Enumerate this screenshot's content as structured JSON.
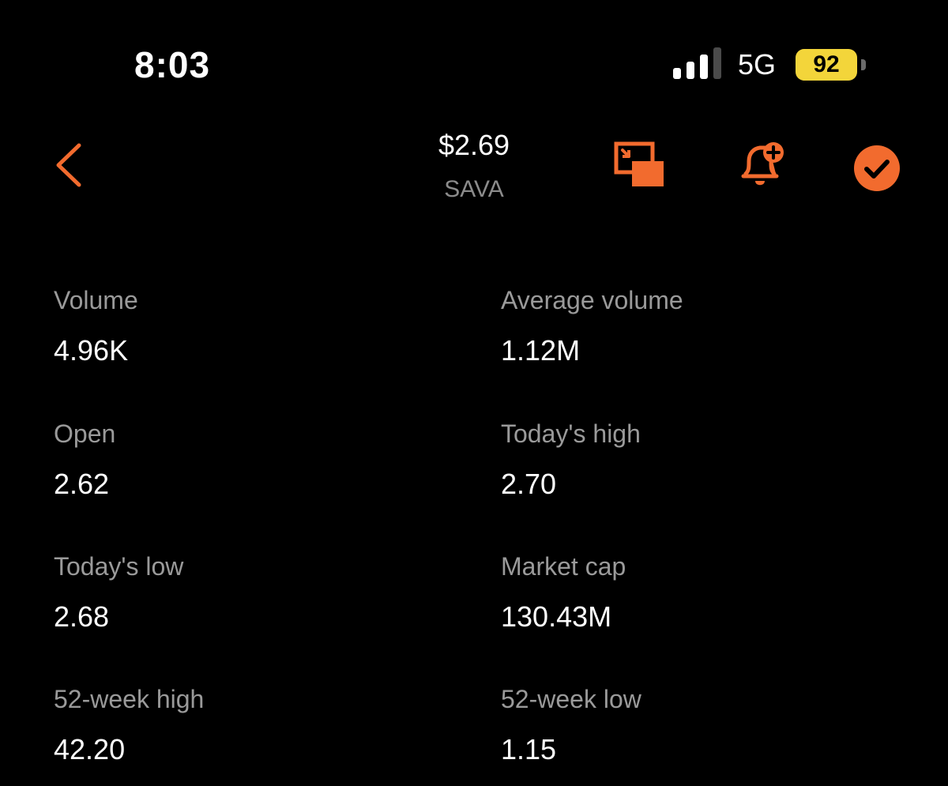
{
  "status_bar": {
    "time": "8:03",
    "network": "5G",
    "battery": "92",
    "signal_bars_active": 3,
    "signal_bars_total": 4
  },
  "header": {
    "price": "$2.69",
    "ticker": "SAVA",
    "icons": [
      "back-chevron-icon",
      "picture-in-picture-icon",
      "bell-plus-icon",
      "checkmark-circle-icon"
    ]
  },
  "stats": {
    "volume": {
      "label": "Volume",
      "value": "4.96K"
    },
    "average_volume": {
      "label": "Average volume",
      "value": "1.12M"
    },
    "open": {
      "label": "Open",
      "value": "2.62"
    },
    "todays_high": {
      "label": "Today's high",
      "value": "2.70"
    },
    "todays_low": {
      "label": "Today's low",
      "value": "2.68"
    },
    "market_cap": {
      "label": "Market cap",
      "value": "130.43M"
    },
    "week52_high": {
      "label": "52-week high",
      "value": "42.20"
    },
    "week52_low": {
      "label": "52-week low",
      "value": "1.15"
    }
  },
  "colors": {
    "background": "#000000",
    "accent": "#f26b2e",
    "label": "#9a9a9a",
    "value": "#ffffff",
    "battery": "#f3d53a"
  }
}
